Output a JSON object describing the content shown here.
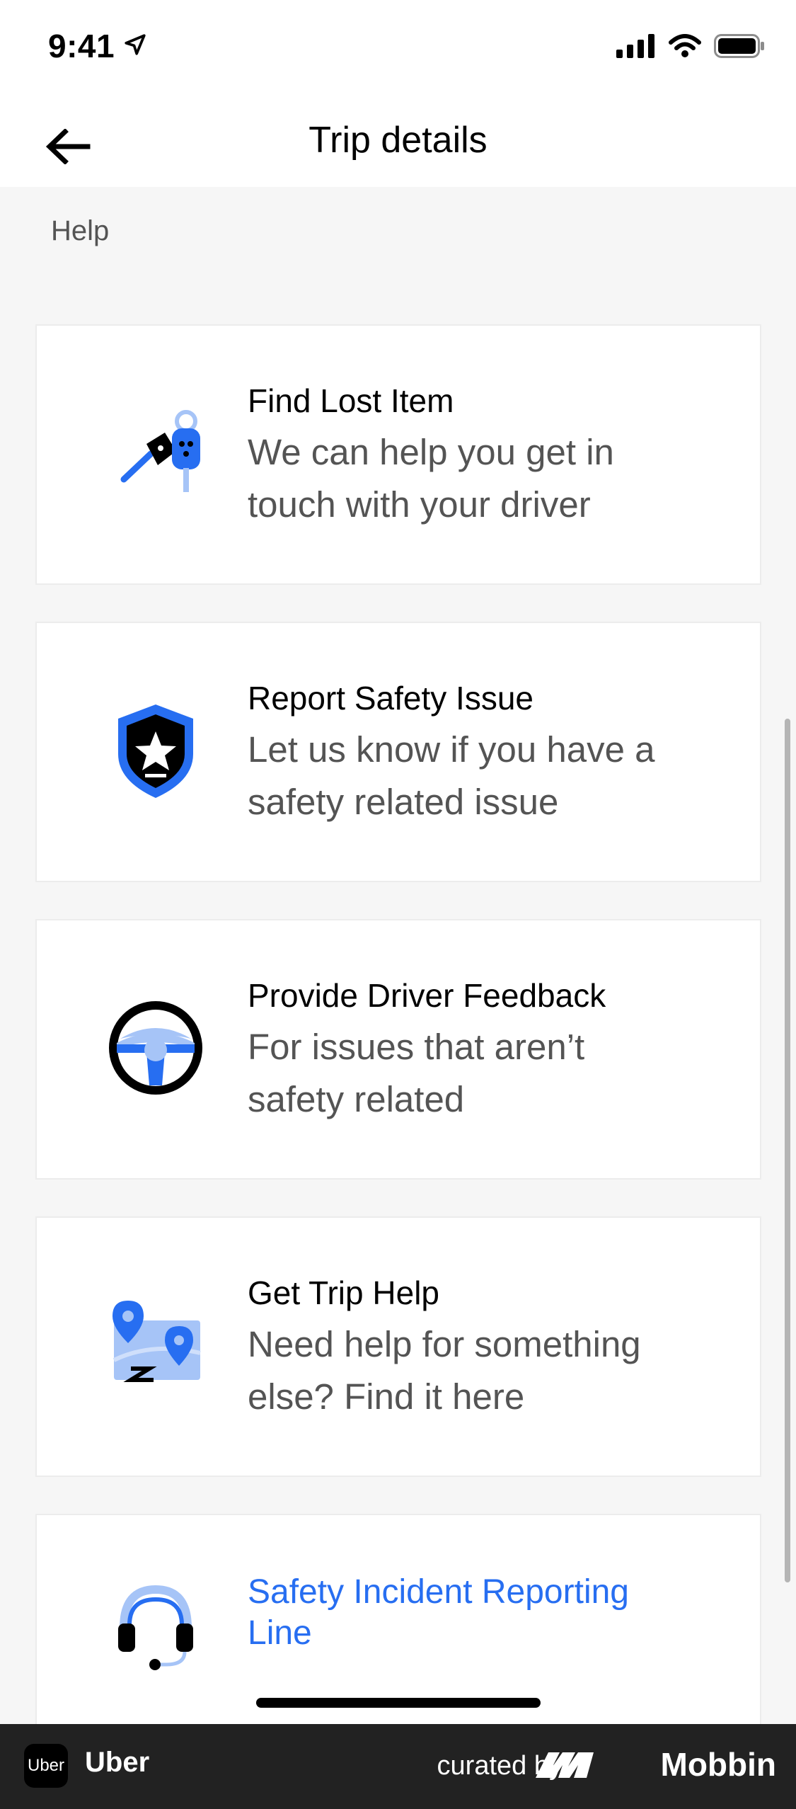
{
  "status_bar": {
    "time": "9:41"
  },
  "header": {
    "title": "Trip details"
  },
  "section": {
    "label": "Help"
  },
  "cards": [
    {
      "title": "Find Lost Item",
      "line1": "We can help you get in",
      "line2": "touch with your driver",
      "icon": "keys-icon"
    },
    {
      "title": "Report Safety Issue",
      "line1": "Let us know if you have a",
      "line2": "safety related issue",
      "icon": "shield-star-icon"
    },
    {
      "title": "Provide Driver Feedback",
      "line1": "For issues that aren’t",
      "line2": "safety related",
      "icon": "steering-wheel-icon"
    },
    {
      "title": "Get Trip Help",
      "line1": "Need help for something",
      "line2": "else? Find it here",
      "icon": "map-pins-icon"
    },
    {
      "title_line1": "Safety Incident Reporting",
      "title_line2": "Line",
      "icon": "headset-icon"
    }
  ],
  "colors": {
    "accent_blue": "#276ef1",
    "light_blue": "#a6c4f7",
    "card_bg": "#ffffff",
    "page_bg": "#f6f6f6"
  },
  "footer": {
    "app_name": "Uber",
    "logo_text": "Uber",
    "curated_label": "curated by",
    "brand": "Mobbin"
  }
}
